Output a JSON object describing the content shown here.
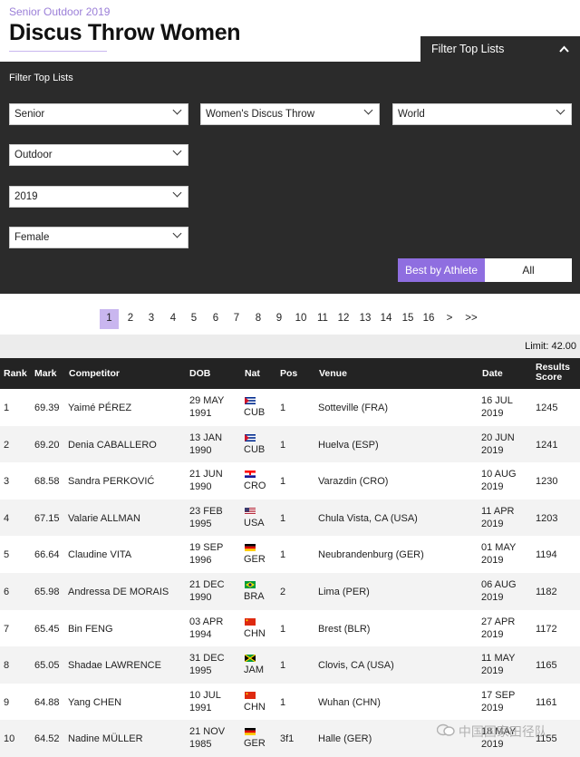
{
  "page": {
    "subtitle": "Senior Outdoor 2019",
    "title": "Discus Throw Women",
    "filter_toggle_label": "Filter Top Lists",
    "filter_toggle_chevron": "^"
  },
  "filters": {
    "label": "Filter Top Lists",
    "age_category": "Senior",
    "event": "Women's Discus Throw",
    "region": "World",
    "environment": "Outdoor",
    "year": "2019",
    "gender": "Female",
    "best_by_athlete": "Best by Athlete",
    "all": "All"
  },
  "pagination": {
    "pages": [
      "1",
      "2",
      "3",
      "4",
      "5",
      "6",
      "7",
      "8",
      "9",
      "10",
      "11",
      "12",
      "13",
      "14",
      "15",
      "16"
    ],
    "active": "1",
    "next": ">",
    "last": ">>"
  },
  "limit": "Limit: 42.00",
  "table": {
    "headers": {
      "rank": "Rank",
      "mark": "Mark",
      "competitor": "Competitor",
      "dob": "DOB",
      "nat": "Nat",
      "pos": "Pos",
      "venue": "Venue",
      "date": "Date",
      "score_line1": "Results",
      "score_line2": "Score"
    },
    "rows": [
      {
        "rank": "1",
        "mark": "69.39",
        "competitor": "Yaimé PÉREZ",
        "dob1": "29 MAY",
        "dob2": "1991",
        "nat": "CUB",
        "pos": "1",
        "venue": "Sotteville (FRA)",
        "date1": "16 JUL",
        "date2": "2019",
        "score": "1245"
      },
      {
        "rank": "2",
        "mark": "69.20",
        "competitor": "Denia CABALLERO",
        "dob1": "13 JAN",
        "dob2": "1990",
        "nat": "CUB",
        "pos": "1",
        "venue": "Huelva (ESP)",
        "date1": "20 JUN",
        "date2": "2019",
        "score": "1241"
      },
      {
        "rank": "3",
        "mark": "68.58",
        "competitor": "Sandra PERKOVIĆ",
        "dob1": "21 JUN",
        "dob2": "1990",
        "nat": "CRO",
        "pos": "1",
        "venue": "Varazdin (CRO)",
        "date1": "10 AUG",
        "date2": "2019",
        "score": "1230"
      },
      {
        "rank": "4",
        "mark": "67.15",
        "competitor": "Valarie ALLMAN",
        "dob1": "23 FEB",
        "dob2": "1995",
        "nat": "USA",
        "pos": "1",
        "venue": "Chula Vista, CA (USA)",
        "date1": "11 APR",
        "date2": "2019",
        "score": "1203"
      },
      {
        "rank": "5",
        "mark": "66.64",
        "competitor": "Claudine VITA",
        "dob1": "19 SEP",
        "dob2": "1996",
        "nat": "GER",
        "pos": "1",
        "venue": "Neubrandenburg (GER)",
        "date1": "01 MAY",
        "date2": "2019",
        "score": "1194"
      },
      {
        "rank": "6",
        "mark": "65.98",
        "competitor": "Andressa DE MORAIS",
        "dob1": "21 DEC",
        "dob2": "1990",
        "nat": "BRA",
        "pos": "2",
        "venue": "Lima (PER)",
        "date1": "06 AUG",
        "date2": "2019",
        "score": "1182"
      },
      {
        "rank": "7",
        "mark": "65.45",
        "competitor": "Bin FENG",
        "dob1": "03 APR",
        "dob2": "1994",
        "nat": "CHN",
        "pos": "1",
        "venue": "Brest (BLR)",
        "date1": "27 APR",
        "date2": "2019",
        "score": "1172"
      },
      {
        "rank": "8",
        "mark": "65.05",
        "competitor": "Shadae LAWRENCE",
        "dob1": "31 DEC",
        "dob2": "1995",
        "nat": "JAM",
        "pos": "1",
        "venue": "Clovis, CA (USA)",
        "date1": "11 MAY",
        "date2": "2019",
        "score": "1165"
      },
      {
        "rank": "9",
        "mark": "64.88",
        "competitor": "Yang CHEN",
        "dob1": "10 JUL",
        "dob2": "1991",
        "nat": "CHN",
        "pos": "1",
        "venue": "Wuhan (CHN)",
        "date1": "17 SEP",
        "date2": "2019",
        "score": "1161"
      },
      {
        "rank": "10",
        "mark": "64.52",
        "competitor": "Nadine MÜLLER",
        "dob1": "21 NOV",
        "dob2": "1985",
        "nat": "GER",
        "pos": "3f1",
        "venue": "Halle (GER)",
        "date1": "18 MAY",
        "date2": "2019",
        "score": "1155"
      }
    ]
  },
  "watermark": "中国国家田径队",
  "colors": {
    "accent": "#8f6ee0",
    "accent_light": "#c9b6ef",
    "panel": "#2b2b2b",
    "header_row": "#232323"
  }
}
